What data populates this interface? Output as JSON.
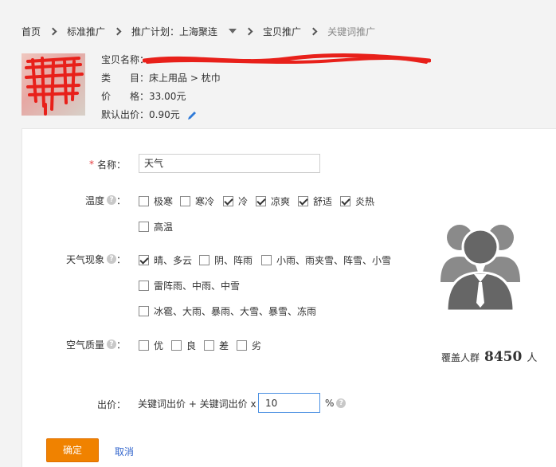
{
  "breadcrumb": {
    "home": "首页",
    "standard": "标准推广",
    "plan": "推广计划：上海聚连",
    "item": "宝贝推广",
    "current": "关键词推广"
  },
  "item": {
    "name_label": "宝贝名称：",
    "category_label": "类　　目：",
    "category_value": "床上用品 > 枕巾",
    "price_label": "价　　格：",
    "price_value": "33.00元",
    "default_bid_label": "默认出价：",
    "default_bid_value": "0.90元"
  },
  "form": {
    "name_required": "*",
    "name_label": "名称：",
    "name_value": "天气",
    "temperature_label": "温度",
    "temperature_options": [
      {
        "label": "极寒",
        "checked": false
      },
      {
        "label": "寒冷",
        "checked": false
      },
      {
        "label": "冷",
        "checked": true
      },
      {
        "label": "凉爽",
        "checked": true
      },
      {
        "label": "舒适",
        "checked": true
      },
      {
        "label": "炎热",
        "checked": true
      },
      {
        "label": "高温",
        "checked": false
      }
    ],
    "weather_label": "天气现象",
    "weather_options": [
      {
        "label": "晴、多云",
        "checked": true
      },
      {
        "label": "阴、阵雨",
        "checked": false
      },
      {
        "label": "小雨、雨夹雪、阵雪、小雪",
        "checked": false
      },
      {
        "label": "雷阵雨、中雨、中雪",
        "checked": false
      },
      {
        "label": "冰雹、大雨、暴雨、大雪、暴雪、冻雨",
        "checked": false
      }
    ],
    "air_label": "空气质量",
    "air_options": [
      {
        "label": "优",
        "checked": false
      },
      {
        "label": "良",
        "checked": false
      },
      {
        "label": "差",
        "checked": false
      },
      {
        "label": "劣",
        "checked": false
      }
    ],
    "colon": "：",
    "help": "?",
    "bid_label": "出价：",
    "bid_formula": "关键词出价 + 关键词出价 x",
    "bid_value": "10",
    "percent": "%",
    "confirm": "确定",
    "cancel": "取消"
  },
  "coverage": {
    "label": "覆盖人群",
    "count": "8450",
    "unit": "人"
  },
  "colors": {
    "accent": "#f08200",
    "link": "#3366cc",
    "required": "#e4393c",
    "avatar": "#666666"
  }
}
